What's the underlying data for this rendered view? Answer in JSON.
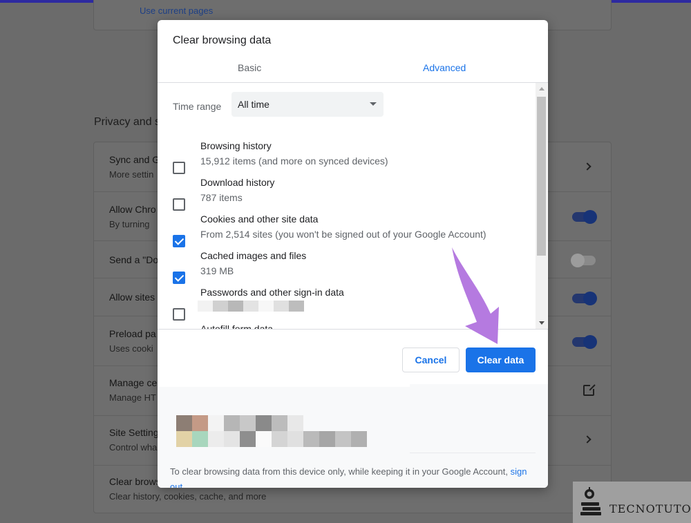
{
  "background": {
    "top_link": "Use current pages",
    "section_title": "Privacy and s",
    "rows": [
      {
        "title": "Sync and G",
        "sub": "More settin",
        "control": "chevron"
      },
      {
        "title": "Allow Chro",
        "sub": "By turning",
        "control": "toggle-on"
      },
      {
        "title": "Send a \"Do",
        "sub": "",
        "control": "toggle-off"
      },
      {
        "title": "Allow sites",
        "sub": "",
        "control": "toggle-on"
      },
      {
        "title": "Preload pa",
        "sub": "Uses cooki",
        "control": "toggle-on"
      },
      {
        "title": "Manage ce",
        "sub": "Manage HT",
        "control": "external-link"
      },
      {
        "title": "Site Setting",
        "sub": "Control wha",
        "control": "chevron"
      },
      {
        "title": "Clear brows",
        "sub": "Clear history, cookies, cache, and more",
        "control": "none"
      }
    ]
  },
  "dialog": {
    "title": "Clear browsing data",
    "tabs": [
      {
        "label": "Basic",
        "active": false
      },
      {
        "label": "Advanced",
        "active": true
      }
    ],
    "time_range": {
      "label": "Time range",
      "value": "All time"
    },
    "items": [
      {
        "label": "Browsing history",
        "sub": "15,912 items (and more on synced devices)",
        "checked": false
      },
      {
        "label": "Download history",
        "sub": "787 items",
        "checked": false
      },
      {
        "label": "Cookies and other site data",
        "sub": "From 2,514 sites (you won't be signed out of your Google Account)",
        "checked": true
      },
      {
        "label": "Cached images and files",
        "sub": "319 MB",
        "checked": true
      },
      {
        "label": "Passwords and other sign-in data",
        "sub": "",
        "checked": false
      },
      {
        "label": "Autofill form data",
        "sub": "",
        "checked": false
      }
    ],
    "buttons": {
      "cancel": "Cancel",
      "clear": "Clear data"
    },
    "footer": {
      "text": "To clear browsing data from this device only, while keeping it in your Google Account,",
      "link": "sign out",
      "period": "."
    }
  },
  "watermark": {
    "text": "TECNOTUTO"
  },
  "colors": {
    "accent": "#1a73e8",
    "arrow": "#b57ae0",
    "overlay": "#6b6b6b"
  }
}
